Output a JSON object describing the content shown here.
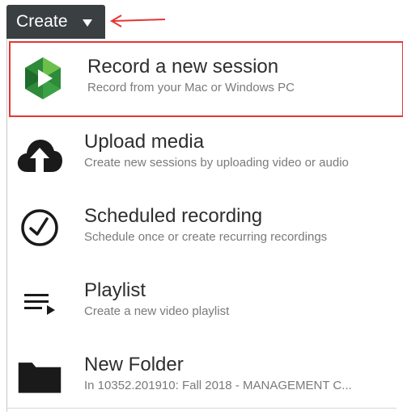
{
  "create_button": {
    "label": "Create",
    "color": "#3a3f42"
  },
  "highlight_color": "#e53535",
  "menu": {
    "items": [
      {
        "title": "Record a new session",
        "subtitle": "Record from your Mac or Windows PC",
        "icon": "panopto-logo-icon"
      },
      {
        "title": "Upload media",
        "subtitle": "Create new sessions by uploading video or audio",
        "icon": "cloud-upload-icon"
      },
      {
        "title": "Scheduled recording",
        "subtitle": "Schedule once or create recurring recordings",
        "icon": "clock-icon"
      },
      {
        "title": "Playlist",
        "subtitle": "Create a new video playlist",
        "icon": "playlist-icon"
      },
      {
        "title": "New Folder",
        "subtitle": "In 10352.201910: Fall 2018 - MANAGEMENT C...",
        "icon": "folder-icon"
      }
    ]
  }
}
